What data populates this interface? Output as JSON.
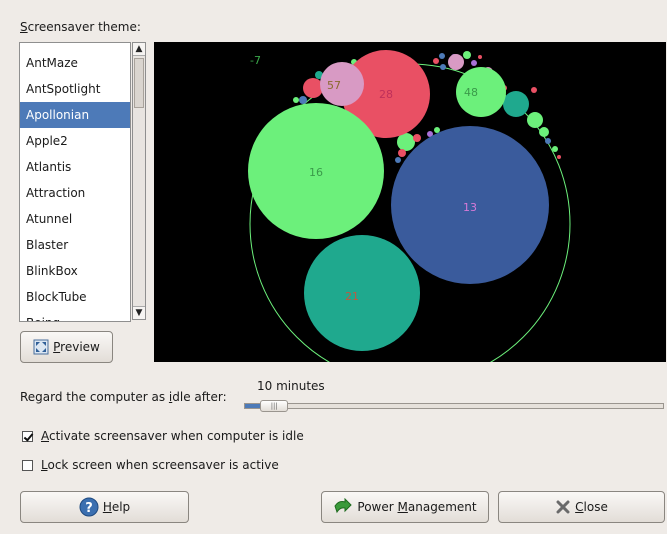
{
  "theme_section": {
    "label_underlined": "S",
    "label_rest": "creensaver theme:",
    "items": [
      "AntMaze",
      "AntSpotlight",
      "Apollonian",
      "Apple2",
      "Atlantis",
      "Attraction",
      "Atunnel",
      "Blaster",
      "BlinkBox",
      "BlockTube",
      "Boing"
    ],
    "selected": "Apollonian"
  },
  "preview_area": {
    "corner_number": "-7",
    "circle_labels": [
      "28",
      "57",
      "48",
      "16",
      "13",
      "21"
    ]
  },
  "preview_button": {
    "underlined": "P",
    "rest": "review"
  },
  "idle": {
    "label_pre": "Regard the computer as ",
    "label_underlined": "i",
    "label_post": "dle after:",
    "value": "10 minutes",
    "level_fraction": 0.07
  },
  "checkboxes": {
    "activate": {
      "underlined": "A",
      "rest": "ctivate screensaver when computer is idle",
      "checked": true
    },
    "lock": {
      "underlined": "L",
      "rest": "ock screen when screensaver is active",
      "checked": false
    }
  },
  "buttons": {
    "help": {
      "underlined": "H",
      "rest": "elp"
    },
    "power": {
      "pre": "Power ",
      "underlined": "M",
      "rest": "anagement"
    },
    "close": {
      "underlined": "C",
      "rest": "lose"
    }
  },
  "colors": {
    "selection": "#4d7ab8",
    "circle_green": "#6cf07b",
    "circle_blue": "#3a5b9c",
    "circle_teal": "#1fa98e",
    "circle_red": "#e95064",
    "circle_pink": "#d89ac4"
  }
}
